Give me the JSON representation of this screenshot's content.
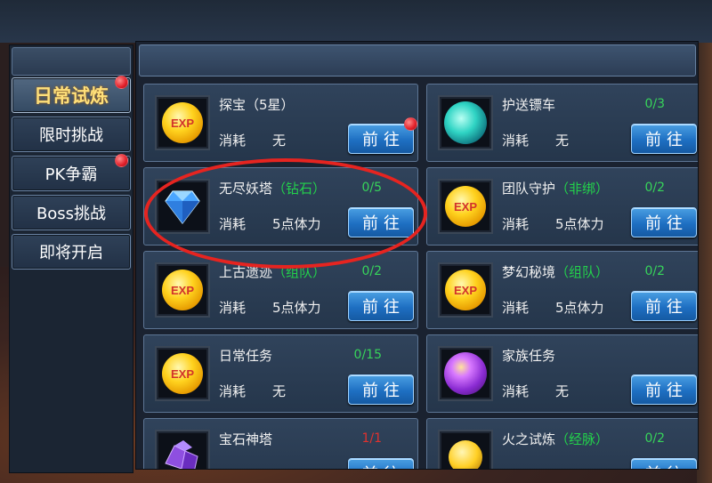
{
  "sidebar": {
    "items": [
      {
        "label": "日常试炼",
        "active": true,
        "red_dot": true
      },
      {
        "label": "限时挑战",
        "active": false,
        "red_dot": false
      },
      {
        "label": "PK争霸",
        "active": false,
        "red_dot": true
      },
      {
        "label": "Boss挑战",
        "active": false,
        "red_dot": false
      },
      {
        "label": "即将开启",
        "active": false,
        "red_dot": false
      }
    ]
  },
  "cost_label": "消耗",
  "go_label": "前往",
  "cards": [
    {
      "title": "探宝",
      "title_paren": "（5星）",
      "paren_color": "white",
      "count": "",
      "cost": "无",
      "icon": "exp-orb-icon",
      "red_dot": true
    },
    {
      "title": "护送镖车",
      "title_paren": "",
      "count": "0/3",
      "cost": "无",
      "icon": "teal-spirit-orb-icon",
      "red_dot": false
    },
    {
      "title": "无尽妖塔",
      "title_paren": "（钻石）",
      "paren_color": "green",
      "count": "0/5",
      "cost": "5点体力",
      "icon": "diamond-icon",
      "red_dot": false
    },
    {
      "title": "团队守护",
      "title_paren": "（非绑）",
      "paren_color": "green",
      "count": "0/2",
      "cost": "5点体力",
      "icon": "exp-orb-icon",
      "red_dot": false
    },
    {
      "title": "上古遗迹",
      "title_paren": "（组队）",
      "paren_color": "green",
      "count": "0/2",
      "cost": "5点体力",
      "icon": "exp-orb-icon",
      "red_dot": false
    },
    {
      "title": "梦幻秘境",
      "title_paren": "（组队）",
      "paren_color": "green",
      "count": "0/2",
      "cost": "5点体力",
      "icon": "exp-orb-icon",
      "red_dot": false
    },
    {
      "title": "日常任务",
      "title_paren": "",
      "count": "0/15",
      "cost": "无",
      "icon": "exp-orb-icon",
      "red_dot": false
    },
    {
      "title": "家族任务",
      "title_paren": "",
      "count": "",
      "cost": "无",
      "icon": "purple-orb-icon",
      "red_dot": false
    },
    {
      "title": "宝石神塔",
      "title_paren": "",
      "count": "1/1",
      "count_color": "red",
      "cost": "",
      "icon": "purple-gem-icon",
      "red_dot": false
    },
    {
      "title": "火之试炼",
      "title_paren": "（经脉）",
      "paren_color": "green",
      "count": "0/2",
      "cost": "",
      "icon": "gold-orb-icon",
      "red_dot": false
    }
  ],
  "colors": {
    "count_green": "#37d45a",
    "count_red": "#e0312e",
    "paren_green": "#23d14b",
    "active_tab_text": "#ffe07a",
    "go_button": "#1e6fc2",
    "highlight": "#e62420"
  }
}
